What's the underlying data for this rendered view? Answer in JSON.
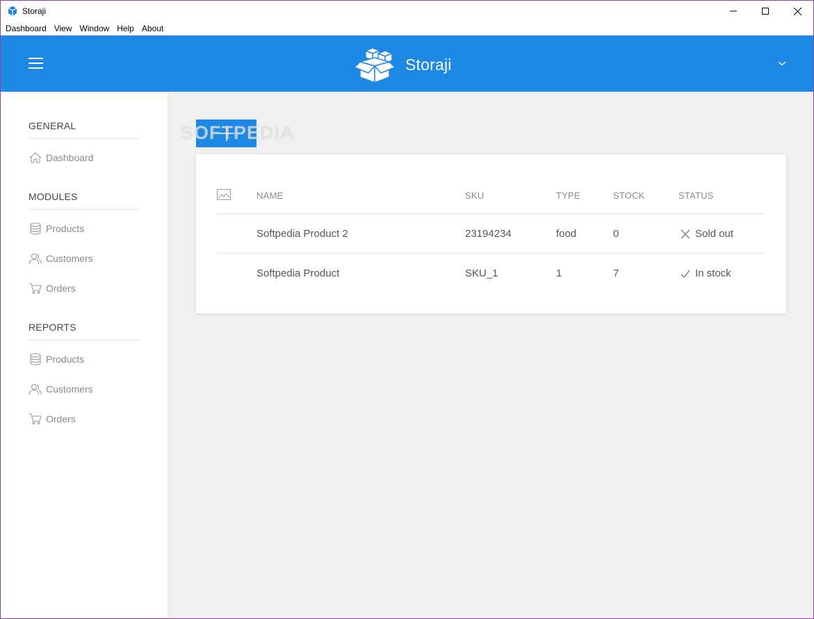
{
  "window": {
    "title": "Storaji"
  },
  "menu": [
    "Dashboard",
    "View",
    "Window",
    "Help",
    "About"
  ],
  "header": {
    "brand": "Storaji",
    "color": "#1e88e5"
  },
  "sidebar": {
    "sections": [
      {
        "title": "GENERAL",
        "items": [
          {
            "label": "Dashboard",
            "icon": "home-icon"
          }
        ]
      },
      {
        "title": "MODULES",
        "items": [
          {
            "label": "Products",
            "icon": "database-icon"
          },
          {
            "label": "Customers",
            "icon": "users-icon"
          },
          {
            "label": "Orders",
            "icon": "cart-icon"
          }
        ]
      },
      {
        "title": "REPORTS",
        "items": [
          {
            "label": "Products",
            "icon": "database-icon"
          },
          {
            "label": "Customers",
            "icon": "users-icon"
          },
          {
            "label": "Orders",
            "icon": "cart-icon"
          }
        ]
      }
    ]
  },
  "main": {
    "add_button_icon": "plus-icon",
    "watermark": "SOFTPEDIA",
    "table": {
      "columns": [
        "NAME",
        "SKU",
        "TYPE",
        "STOCK",
        "STATUS"
      ],
      "rows": [
        {
          "name": "Softpedia Product 2",
          "sku": "23194234",
          "type": "food",
          "stock": "0",
          "status": "Sold out",
          "status_icon": "x-icon"
        },
        {
          "name": "Softpedia Product",
          "sku": "SKU_1",
          "type": "1",
          "stock": "7",
          "status": "In stock",
          "status_icon": "check-icon"
        }
      ]
    }
  }
}
